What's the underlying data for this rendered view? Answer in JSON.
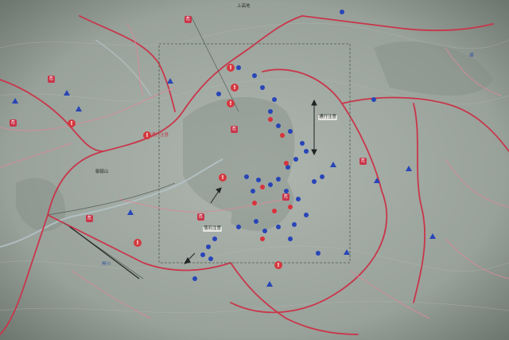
{
  "map": {
    "labels": {
      "kamikouchi": "上高地",
      "mt_ontake": "御嶽山",
      "lake": "湖",
      "notice_a": "通行注意",
      "notice_b": "落石注意",
      "route_note": "通行注意",
      "river": "梓川"
    },
    "warning_symbol": "!",
    "hazard_symbol": "危",
    "colors": {
      "background": "#9aa39c",
      "road_red": "#c9364a",
      "trail_pink": "#d98b9a",
      "blue_marker": "#2845b8",
      "red_marker": "#d8323c",
      "dashed_box": "#4d5a52"
    }
  }
}
